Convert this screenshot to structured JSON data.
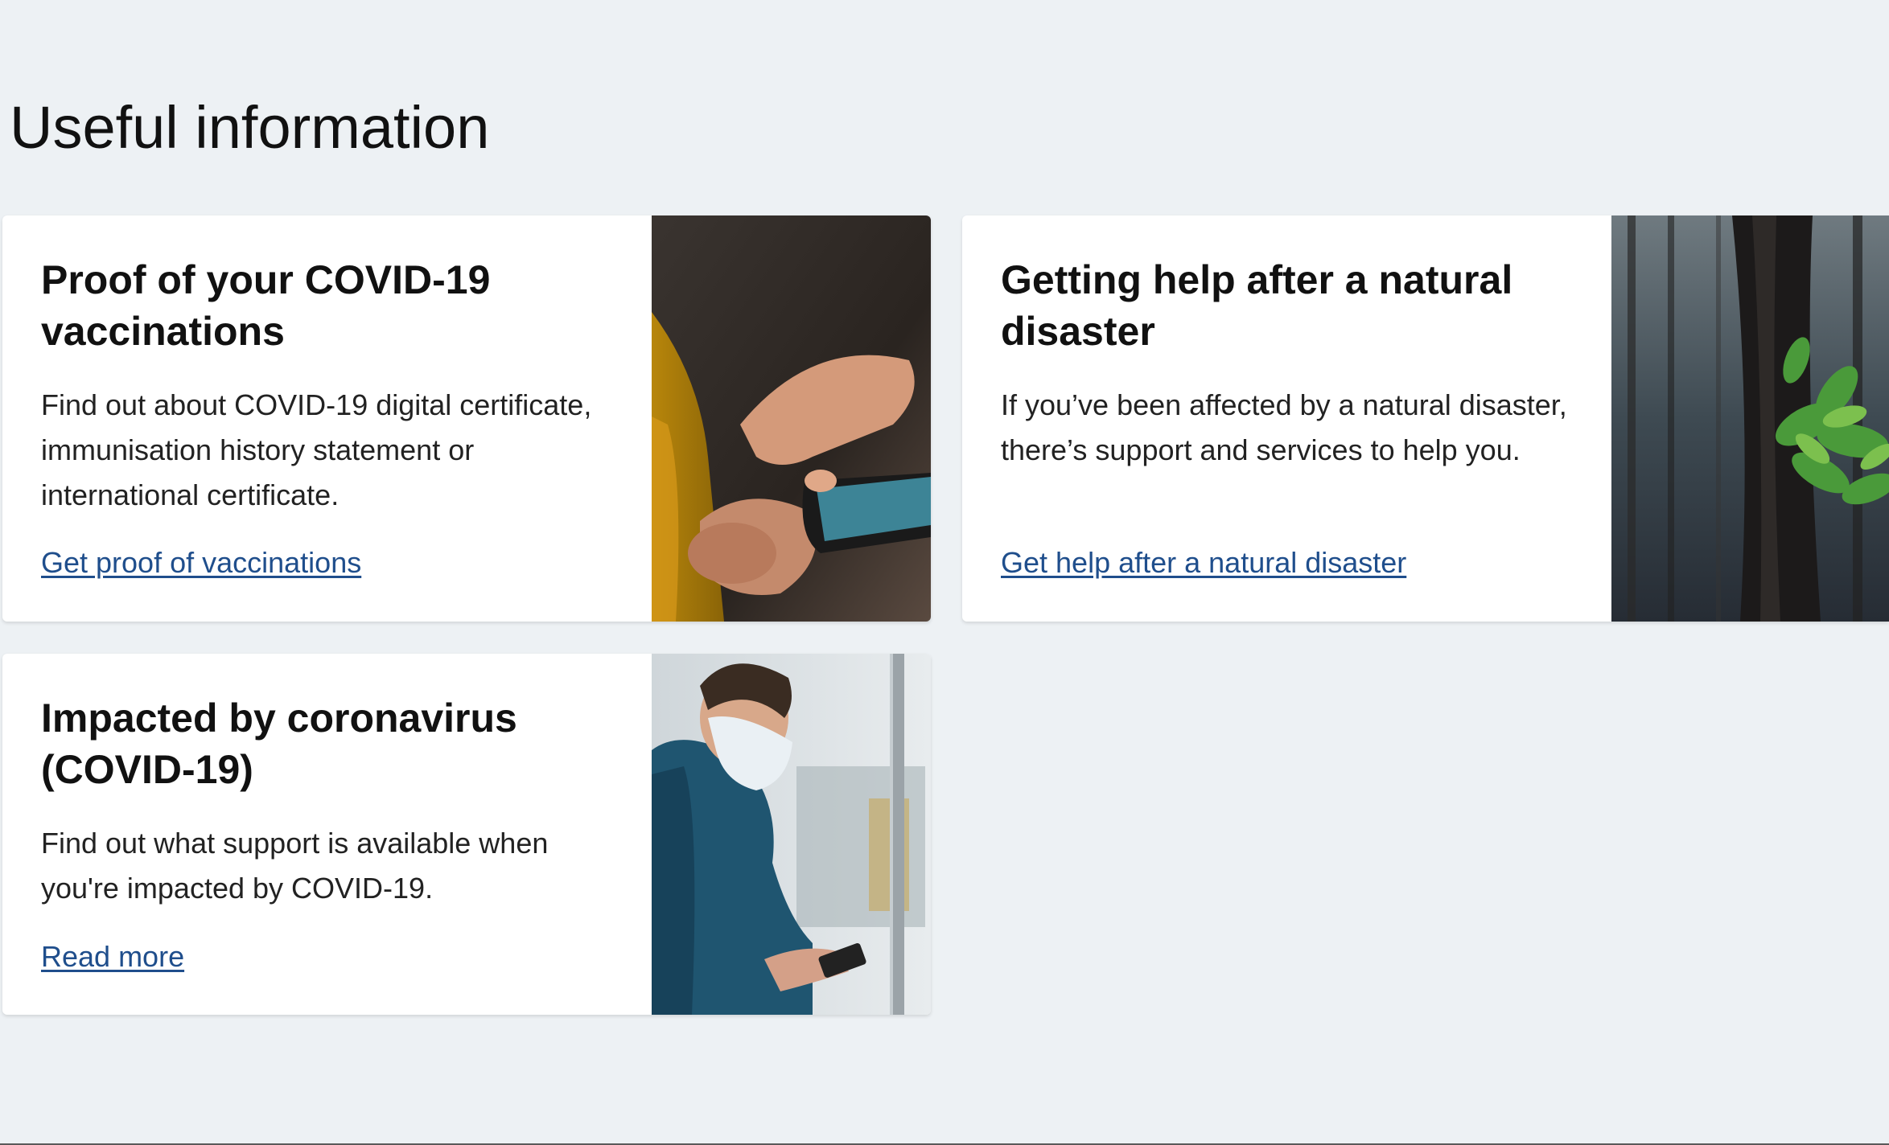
{
  "section": {
    "title": "Useful information"
  },
  "cards": [
    {
      "title": "Proof of your COVID-19 vaccinations",
      "description": "Find out about COVID-19 digital certificate, immunisation history statement or international certificate.",
      "link": "Get proof of vaccinations",
      "image": "hand-holding-phone-photo"
    },
    {
      "title": "Getting help after a natural disaster",
      "description": "If you’ve been affected by a natural disaster, there’s support and services to help you.",
      "link": "Get help after a natural disaster",
      "image": "burnt-tree-regrowth-photo"
    },
    {
      "title": "Impacted by coronavirus (COVID-19)",
      "description": "Find out what support is available when you're impacted by COVID-19.",
      "link": "Read more",
      "image": "masked-commuter-photo"
    }
  ],
  "colors": {
    "page_background": "#edf1f4",
    "card_background": "#ffffff",
    "link": "#1f4e8c",
    "heading": "#111111"
  }
}
